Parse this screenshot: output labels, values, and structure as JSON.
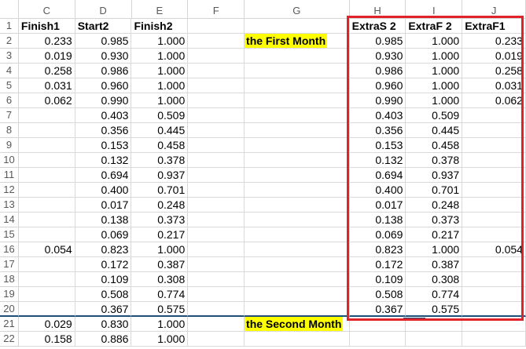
{
  "columns": [
    "C",
    "D",
    "E",
    "F",
    "G",
    "H",
    "I",
    "J"
  ],
  "header_row": {
    "number": "1",
    "cells": [
      "Finish1",
      "Start2",
      "Finish2",
      "",
      "",
      "ExtraS 2",
      "ExtraF 2",
      "ExtraF1"
    ]
  },
  "highlight_color": "#ffff00",
  "annotation_box_color": "#e2222b",
  "labels": {
    "first_month": "the First Month",
    "second_month": "the Second Month"
  },
  "rows": [
    {
      "n": "2",
      "c": "0.233",
      "d": "0.985",
      "e": "1.000",
      "g": "the First Month",
      "h": "0.985",
      "i": "1.000",
      "j": "0.233"
    },
    {
      "n": "3",
      "c": "0.019",
      "d": "0.930",
      "e": "1.000",
      "g": "",
      "h": "0.930",
      "i": "1.000",
      "j": "0.019"
    },
    {
      "n": "4",
      "c": "0.258",
      "d": "0.986",
      "e": "1.000",
      "g": "",
      "h": "0.986",
      "i": "1.000",
      "j": "0.258"
    },
    {
      "n": "5",
      "c": "0.031",
      "d": "0.960",
      "e": "1.000",
      "g": "",
      "h": "0.960",
      "i": "1.000",
      "j": "0.031"
    },
    {
      "n": "6",
      "c": "0.062",
      "d": "0.990",
      "e": "1.000",
      "g": "",
      "h": "0.990",
      "i": "1.000",
      "j": "0.062"
    },
    {
      "n": "7",
      "c": "",
      "d": "0.403",
      "e": "0.509",
      "g": "",
      "h": "0.403",
      "i": "0.509",
      "j": ""
    },
    {
      "n": "8",
      "c": "",
      "d": "0.356",
      "e": "0.445",
      "g": "",
      "h": "0.356",
      "i": "0.445",
      "j": ""
    },
    {
      "n": "9",
      "c": "",
      "d": "0.153",
      "e": "0.458",
      "g": "",
      "h": "0.153",
      "i": "0.458",
      "j": ""
    },
    {
      "n": "10",
      "c": "",
      "d": "0.132",
      "e": "0.378",
      "g": "",
      "h": "0.132",
      "i": "0.378",
      "j": ""
    },
    {
      "n": "11",
      "c": "",
      "d": "0.694",
      "e": "0.937",
      "g": "",
      "h": "0.694",
      "i": "0.937",
      "j": ""
    },
    {
      "n": "12",
      "c": "",
      "d": "0.400",
      "e": "0.701",
      "g": "",
      "h": "0.400",
      "i": "0.701",
      "j": ""
    },
    {
      "n": "13",
      "c": "",
      "d": "0.017",
      "e": "0.248",
      "g": "",
      "h": "0.017",
      "i": "0.248",
      "j": ""
    },
    {
      "n": "14",
      "c": "",
      "d": "0.138",
      "e": "0.373",
      "g": "",
      "h": "0.138",
      "i": "0.373",
      "j": ""
    },
    {
      "n": "15",
      "c": "",
      "d": "0.069",
      "e": "0.217",
      "g": "",
      "h": "0.069",
      "i": "0.217",
      "j": ""
    },
    {
      "n": "16",
      "c": "0.054",
      "d": "0.823",
      "e": "1.000",
      "g": "",
      "h": "0.823",
      "i": "1.000",
      "j": "0.054"
    },
    {
      "n": "17",
      "c": "",
      "d": "0.172",
      "e": "0.387",
      "g": "",
      "h": "0.172",
      "i": "0.387",
      "j": ""
    },
    {
      "n": "18",
      "c": "",
      "d": "0.109",
      "e": "0.308",
      "g": "",
      "h": "0.109",
      "i": "0.308",
      "j": ""
    },
    {
      "n": "19",
      "c": "",
      "d": "0.508",
      "e": "0.774",
      "g": "",
      "h": "0.508",
      "i": "0.774",
      "j": ""
    },
    {
      "n": "20",
      "c": "",
      "d": "0.367",
      "e": "0.575",
      "g": "",
      "h": "0.367",
      "i": "0.575",
      "j": ""
    },
    {
      "n": "21",
      "c": "0.029",
      "d": "0.830",
      "e": "1.000",
      "g": "the Second Month",
      "h": "",
      "i": "",
      "j": ""
    },
    {
      "n": "22",
      "c": "0.158",
      "d": "0.886",
      "e": "1.000",
      "g": "",
      "h": "",
      "i": "",
      "j": ""
    }
  ]
}
